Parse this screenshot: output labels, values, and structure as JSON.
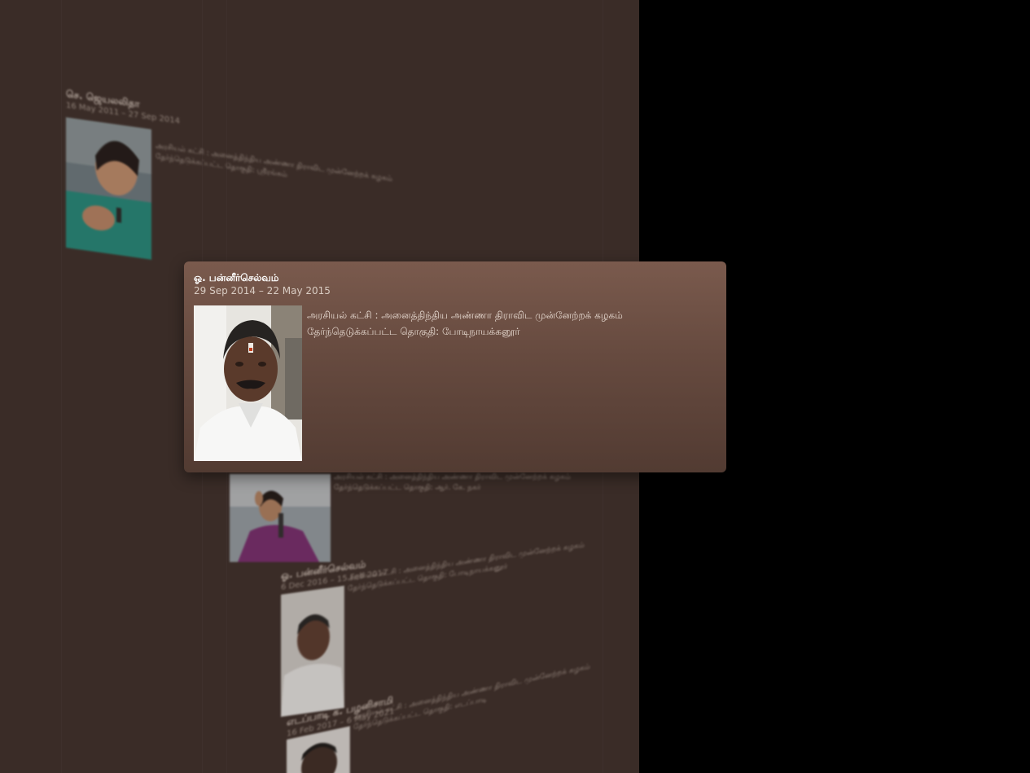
{
  "background_entries": [
    {
      "name": "செ. ஜெயலலிதா",
      "dates": "16 May 2011 – 27 Sep 2014",
      "party_line": "அரசியல் கட்சி : அனைத்திந்திய அண்ணா திராவிட முன்னேற்றக் கழகம்",
      "constituency_line": "தேர்ந்தெடுக்கப்பட்ட தொகுதி: ஸ்ரீரங்கம்"
    },
    {
      "name": "",
      "dates": "",
      "party_line": "அரசியல் கட்சி : அனைத்திந்திய அண்ணா திராவிட முன்னேற்றக் கழகம்",
      "constituency_line": "தேர்ந்தெடுக்கப்பட்ட தொகுதி: ஆர். கே. நகர்"
    },
    {
      "name": "ஓ. பன்னீர்செல்வம்",
      "dates": "6 Dec 2016 – 15 Feb 2017",
      "party_line": "அரசியல் கட்சி : அனைத்திந்திய அண்ணா திராவிட முன்னேற்றக் கழகம்",
      "constituency_line": "தேர்ந்தெடுக்கப்பட்ட தொகுதி: போடிநாயக்கனூர்"
    },
    {
      "name": "எடப்பாடி க. பழனிசாமி",
      "dates": "16 Feb 2017 – 6 May 2021",
      "party_line": "அரசியல் கட்சி : அனைத்திந்திய அண்ணா திராவிட முன்னேற்றக் கழகம்",
      "constituency_line": "தேர்ந்தெடுக்கப்பட்ட தொகுதி: எடப்பாடி"
    }
  ],
  "card": {
    "name": "ஓ. பன்னீர்செல்வம்",
    "dates": "29 Sep 2014 – 22 May 2015",
    "party_line": "அரசியல் கட்சி : அனைத்திந்திய அண்ணா திராவிட முன்னேற்றக் கழகம்",
    "constituency_line": "தேர்ந்தெடுக்கப்பட்ட தொகுதி: போடிநாயக்கனூர்"
  },
  "colors": {
    "panel": "#3a2c27",
    "card_top": "#7a5a4d",
    "card_bottom": "#523b32",
    "outside": "#000000"
  }
}
